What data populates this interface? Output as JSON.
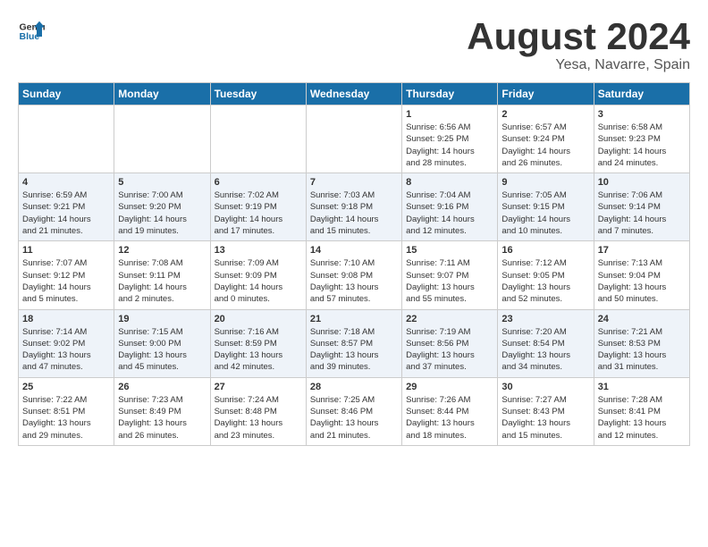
{
  "header": {
    "logo_general": "General",
    "logo_blue": "Blue",
    "month_year": "August 2024",
    "location": "Yesa, Navarre, Spain"
  },
  "weekdays": [
    "Sunday",
    "Monday",
    "Tuesday",
    "Wednesday",
    "Thursday",
    "Friday",
    "Saturday"
  ],
  "weeks": [
    [
      {
        "day": "",
        "info": ""
      },
      {
        "day": "",
        "info": ""
      },
      {
        "day": "",
        "info": ""
      },
      {
        "day": "",
        "info": ""
      },
      {
        "day": "1",
        "info": "Sunrise: 6:56 AM\nSunset: 9:25 PM\nDaylight: 14 hours\nand 28 minutes."
      },
      {
        "day": "2",
        "info": "Sunrise: 6:57 AM\nSunset: 9:24 PM\nDaylight: 14 hours\nand 26 minutes."
      },
      {
        "day": "3",
        "info": "Sunrise: 6:58 AM\nSunset: 9:23 PM\nDaylight: 14 hours\nand 24 minutes."
      }
    ],
    [
      {
        "day": "4",
        "info": "Sunrise: 6:59 AM\nSunset: 9:21 PM\nDaylight: 14 hours\nand 21 minutes."
      },
      {
        "day": "5",
        "info": "Sunrise: 7:00 AM\nSunset: 9:20 PM\nDaylight: 14 hours\nand 19 minutes."
      },
      {
        "day": "6",
        "info": "Sunrise: 7:02 AM\nSunset: 9:19 PM\nDaylight: 14 hours\nand 17 minutes."
      },
      {
        "day": "7",
        "info": "Sunrise: 7:03 AM\nSunset: 9:18 PM\nDaylight: 14 hours\nand 15 minutes."
      },
      {
        "day": "8",
        "info": "Sunrise: 7:04 AM\nSunset: 9:16 PM\nDaylight: 14 hours\nand 12 minutes."
      },
      {
        "day": "9",
        "info": "Sunrise: 7:05 AM\nSunset: 9:15 PM\nDaylight: 14 hours\nand 10 minutes."
      },
      {
        "day": "10",
        "info": "Sunrise: 7:06 AM\nSunset: 9:14 PM\nDaylight: 14 hours\nand 7 minutes."
      }
    ],
    [
      {
        "day": "11",
        "info": "Sunrise: 7:07 AM\nSunset: 9:12 PM\nDaylight: 14 hours\nand 5 minutes."
      },
      {
        "day": "12",
        "info": "Sunrise: 7:08 AM\nSunset: 9:11 PM\nDaylight: 14 hours\nand 2 minutes."
      },
      {
        "day": "13",
        "info": "Sunrise: 7:09 AM\nSunset: 9:09 PM\nDaylight: 14 hours\nand 0 minutes."
      },
      {
        "day": "14",
        "info": "Sunrise: 7:10 AM\nSunset: 9:08 PM\nDaylight: 13 hours\nand 57 minutes."
      },
      {
        "day": "15",
        "info": "Sunrise: 7:11 AM\nSunset: 9:07 PM\nDaylight: 13 hours\nand 55 minutes."
      },
      {
        "day": "16",
        "info": "Sunrise: 7:12 AM\nSunset: 9:05 PM\nDaylight: 13 hours\nand 52 minutes."
      },
      {
        "day": "17",
        "info": "Sunrise: 7:13 AM\nSunset: 9:04 PM\nDaylight: 13 hours\nand 50 minutes."
      }
    ],
    [
      {
        "day": "18",
        "info": "Sunrise: 7:14 AM\nSunset: 9:02 PM\nDaylight: 13 hours\nand 47 minutes."
      },
      {
        "day": "19",
        "info": "Sunrise: 7:15 AM\nSunset: 9:00 PM\nDaylight: 13 hours\nand 45 minutes."
      },
      {
        "day": "20",
        "info": "Sunrise: 7:16 AM\nSunset: 8:59 PM\nDaylight: 13 hours\nand 42 minutes."
      },
      {
        "day": "21",
        "info": "Sunrise: 7:18 AM\nSunset: 8:57 PM\nDaylight: 13 hours\nand 39 minutes."
      },
      {
        "day": "22",
        "info": "Sunrise: 7:19 AM\nSunset: 8:56 PM\nDaylight: 13 hours\nand 37 minutes."
      },
      {
        "day": "23",
        "info": "Sunrise: 7:20 AM\nSunset: 8:54 PM\nDaylight: 13 hours\nand 34 minutes."
      },
      {
        "day": "24",
        "info": "Sunrise: 7:21 AM\nSunset: 8:53 PM\nDaylight: 13 hours\nand 31 minutes."
      }
    ],
    [
      {
        "day": "25",
        "info": "Sunrise: 7:22 AM\nSunset: 8:51 PM\nDaylight: 13 hours\nand 29 minutes."
      },
      {
        "day": "26",
        "info": "Sunrise: 7:23 AM\nSunset: 8:49 PM\nDaylight: 13 hours\nand 26 minutes."
      },
      {
        "day": "27",
        "info": "Sunrise: 7:24 AM\nSunset: 8:48 PM\nDaylight: 13 hours\nand 23 minutes."
      },
      {
        "day": "28",
        "info": "Sunrise: 7:25 AM\nSunset: 8:46 PM\nDaylight: 13 hours\nand 21 minutes."
      },
      {
        "day": "29",
        "info": "Sunrise: 7:26 AM\nSunset: 8:44 PM\nDaylight: 13 hours\nand 18 minutes."
      },
      {
        "day": "30",
        "info": "Sunrise: 7:27 AM\nSunset: 8:43 PM\nDaylight: 13 hours\nand 15 minutes."
      },
      {
        "day": "31",
        "info": "Sunrise: 7:28 AM\nSunset: 8:41 PM\nDaylight: 13 hours\nand 12 minutes."
      }
    ]
  ]
}
